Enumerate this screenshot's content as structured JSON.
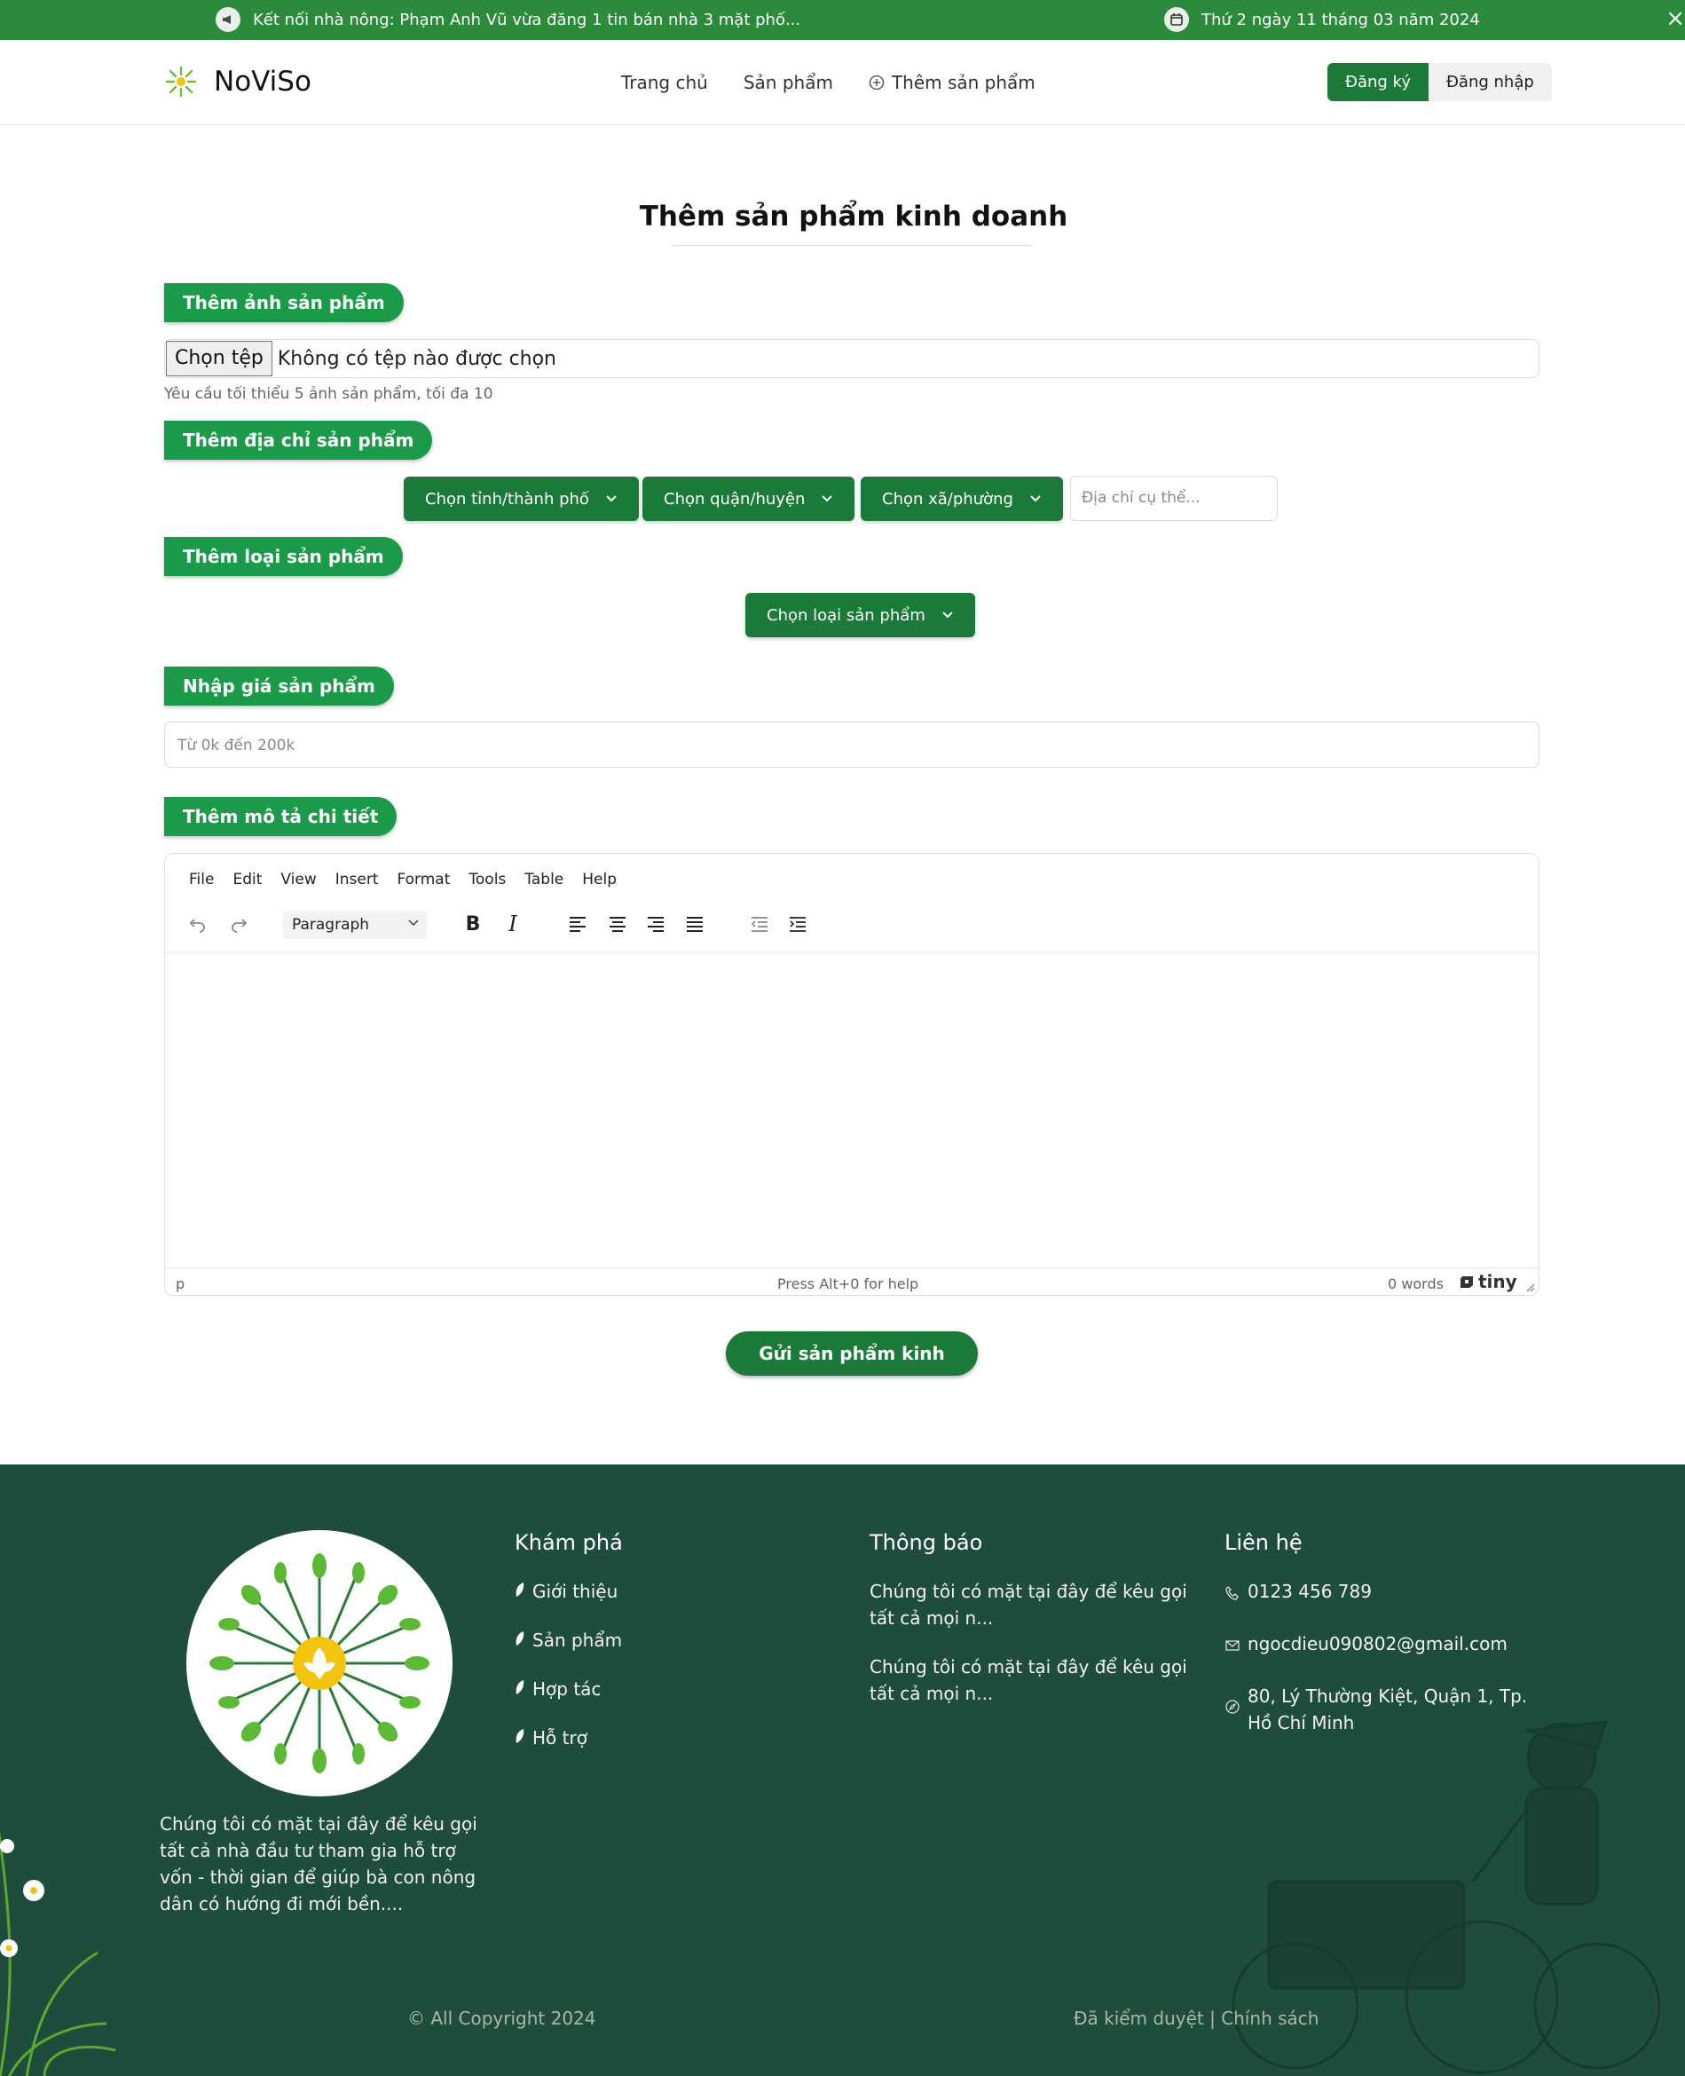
{
  "topbar": {
    "announcement": "Kết nối nhà nông: Phạm Anh Vũ vừa đăng 1 tin bán nhà 3 mặt phố...",
    "date": "Thứ 2 ngày 11 tháng 03 năm 2024",
    "close": "×"
  },
  "header": {
    "brand": "NoViSo",
    "nav": [
      "Trang chủ",
      "Sản phẩm",
      "Thêm sản phẩm"
    ],
    "register": "Đăng ký",
    "login": "Đăng nhập"
  },
  "form": {
    "title": "Thêm sản phẩm kinh doanh",
    "image_label": "Thêm ảnh sản phẩm",
    "file_button": "Chọn tệp",
    "file_status": "Không có tệp nào được chọn",
    "image_hint": "Yêu cầu tối thiểu 5 ảnh sản phẩm, tối đa 10",
    "address_label": "Thêm địa chỉ sản phẩm",
    "province": "Chọn tỉnh/thành phố",
    "district": "Chọn quận/huyện",
    "ward": "Chọn xã/phường",
    "address_placeholder": "Địa chỉ cụ thể...",
    "type_label": "Thêm loại sản phẩm",
    "type_select": "Chọn loại sản phẩm",
    "price_label": "Nhập giá sản phẩm",
    "price_placeholder": "Từ 0k đến 200k",
    "desc_label": "Thêm mô tả chi tiết",
    "submit": "Gửi sản phẩm kinh doanh"
  },
  "editor": {
    "menu": [
      "File",
      "Edit",
      "View",
      "Insert",
      "Format",
      "Tools",
      "Table",
      "Help"
    ],
    "block_format": "Paragraph",
    "status_path": "p",
    "status_help": "Press Alt+0 for help",
    "word_count": "0 words",
    "brand": "tiny"
  },
  "footer": {
    "about": "Chúng tôi có mặt tại đây để kêu gọi tất cả nhà đầu tư tham gia hỗ trợ vốn - thời gian để giúp bà con nông dân có hướng đi mới bền....",
    "explore_title": "Khám phá",
    "explore_items": [
      "Giới thiệu",
      "Sản phẩm",
      "Hợp tác",
      "Hỗ trợ"
    ],
    "news_title": "Thông báo",
    "news_items": [
      "Chúng tôi có mặt tại đây để kêu gọi tất cả mọi n...",
      "Chúng tôi có mặt tại đây để kêu gọi tất cả mọi n..."
    ],
    "contact_title": "Liên hệ",
    "phone": "0123 456 789",
    "email": "ngocdieu090802@gmail.com",
    "address": "80, Lý Thường Kiệt, Quận 1, Tp. Hồ Chí Minh",
    "copyright": "© All Copyright 2024",
    "policy": "Đã kiểm duyệt | Chính sách"
  },
  "colors": {
    "topbar": "#2c8a3c",
    "primary": "#1b7a3a",
    "pill": "#1b9b4a",
    "footer": "#1f4d3b"
  }
}
